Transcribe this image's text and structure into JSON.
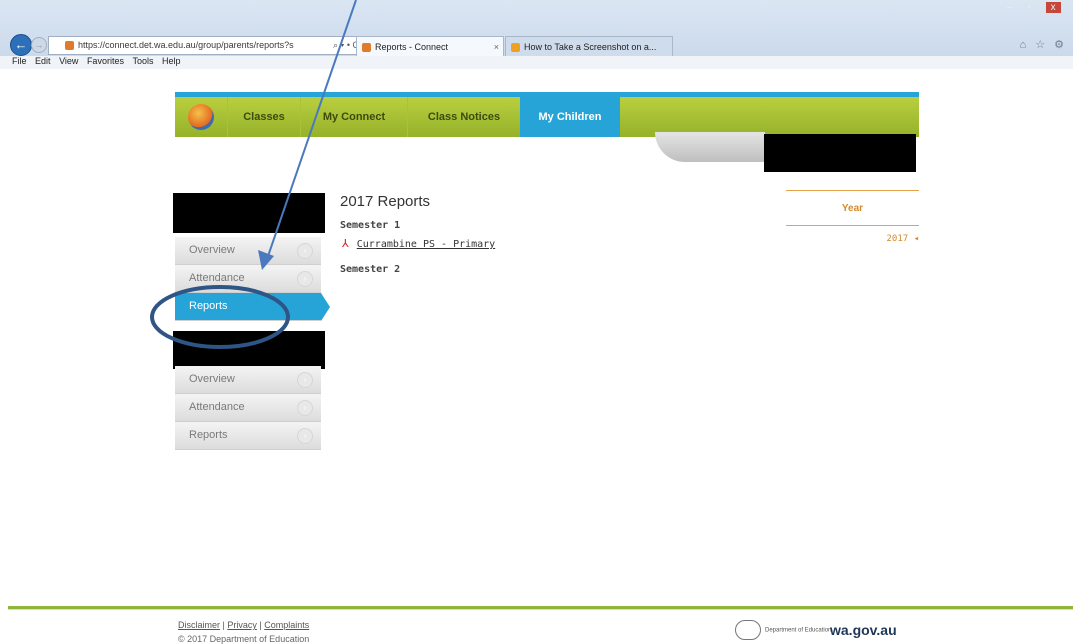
{
  "browser": {
    "url": "https://connect.det.wa.edu.au/group/parents/reports?s",
    "url_tools": "⌕ ▾ • C",
    "tabs": [
      {
        "label": "Reports - Connect",
        "close": "×",
        "icon_color": "#e07b2a"
      },
      {
        "label": "How to Take a Screenshot on a...",
        "icon_color": "#f0a020"
      }
    ],
    "menu": [
      "File",
      "Edit",
      "View",
      "Favorites",
      "Tools",
      "Help"
    ],
    "back_glyph": "←",
    "fwd_glyph": "→"
  },
  "nav": {
    "items": [
      "Classes",
      "My Connect",
      "Class Notices",
      "My Children"
    ],
    "active": "My Children",
    "accent": "#26a3d7",
    "green": "#a6c336"
  },
  "sidebar": {
    "group1": [
      "Overview",
      "Attendance",
      "Reports"
    ],
    "group1_active": "Reports",
    "group2": [
      "Overview",
      "Attendance",
      "Reports"
    ]
  },
  "content": {
    "title": "2017 Reports",
    "semester1": "Semester 1",
    "report_link": "Currambine PS - Primary",
    "semester2": "Semester 2"
  },
  "year_panel": {
    "heading": "Year",
    "value": "2017 ◂"
  },
  "footer": {
    "links": [
      "Disclaimer",
      "Privacy",
      "Complaints"
    ],
    "separator": " | ",
    "copyright": "© 2017 Department of Education",
    "dept": "Department of Education",
    "site": "wa.gov.au"
  }
}
